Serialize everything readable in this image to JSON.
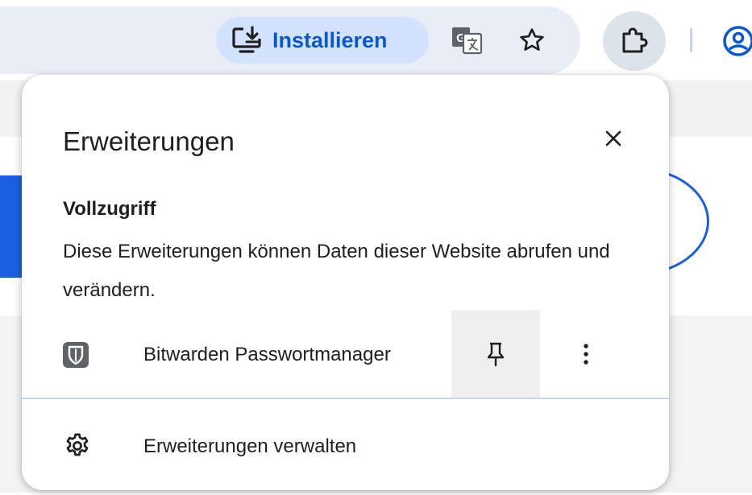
{
  "toolbar": {
    "install_label": "Installieren",
    "icons": [
      "install-app-icon",
      "translate-icon",
      "bookmark-star-icon",
      "extensions-puzzle-icon",
      "profile-icon"
    ],
    "translate_glyph": "G",
    "accent_color": "#0b57d0"
  },
  "popup": {
    "title": "Erweiterungen",
    "section_title": "Vollzugriff",
    "section_description": "Diese Erweiterungen können Daten dieser Website abrufen und verändern.",
    "extensions": [
      {
        "name": "Bitwarden Passwortmanager",
        "icon": "bitwarden-shield-icon"
      }
    ],
    "manage_label": "Erweiterungen verwalten"
  }
}
